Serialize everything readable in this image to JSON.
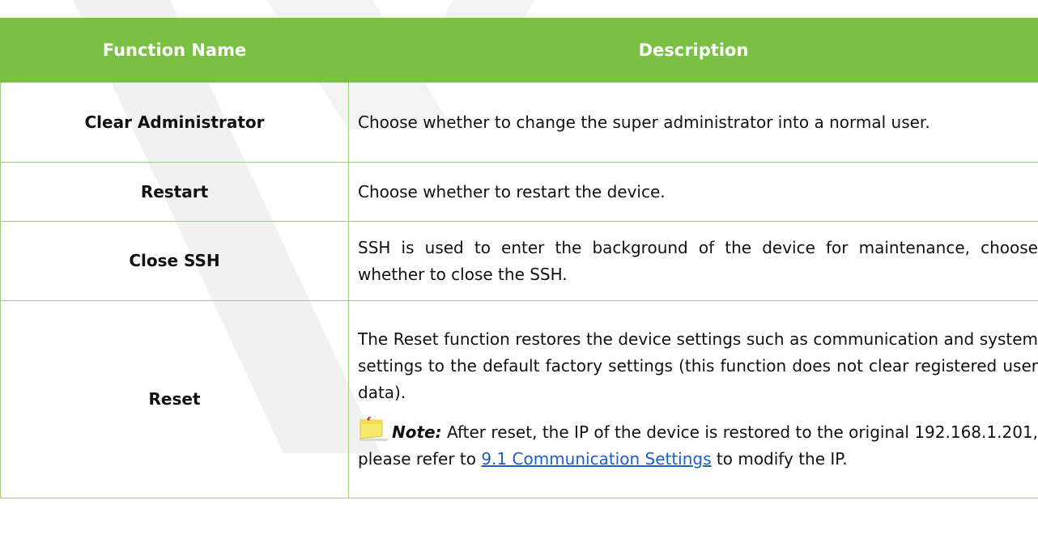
{
  "table": {
    "headers": [
      "Function Name",
      "Description"
    ],
    "rows": [
      {
        "name": "Clear Administrator",
        "description": "Choose whether to change the super administrator into a normal user."
      },
      {
        "name": "Restart",
        "description": "Choose whether to restart the device."
      },
      {
        "name": "Close SSH",
        "description": "SSH is used to enter the background of the device for maintenance, choose whether to close the SSH."
      },
      {
        "name": "Reset",
        "description": "The Reset function restores the device settings such as communication and system settings to the default factory settings (this function does not clear registered user data).",
        "note": {
          "icon": "sticky-note-icon",
          "label": "Note:",
          "text_before": " After reset, the IP of the device is restored to the original 192.168.1.201, please refer to ",
          "link_text": "9.1 Communication Settings",
          "text_after": " to modify the IP."
        }
      }
    ]
  },
  "colors": {
    "header_bg": "#7ac143",
    "header_text": "#ffffff",
    "border": "#9fce7a",
    "link": "#1f5fc4",
    "watermark": "#eeeeee"
  }
}
